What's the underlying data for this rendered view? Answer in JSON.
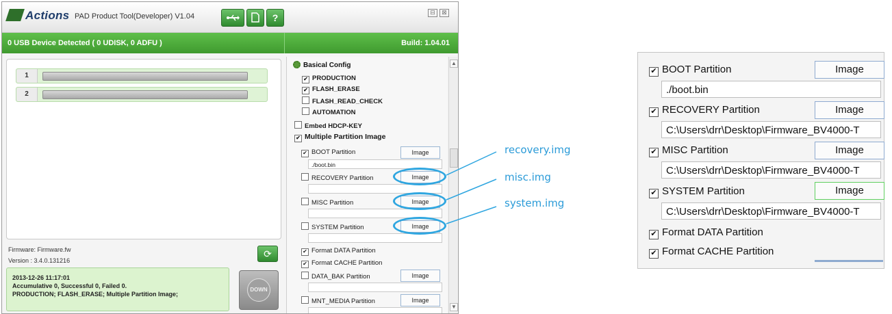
{
  "app": {
    "logo": "Actions",
    "title": "PAD Product Tool(Developer) V1.04",
    "toolbar": {
      "usb_icon": "usb-icon",
      "doc_icon": "document-icon",
      "help_label": "?"
    },
    "window_controls": {
      "minimize": "⊟",
      "close": "⊠"
    }
  },
  "status": {
    "left": "0 USB Device Detected ( 0 UDISK, 0 ADFU )",
    "right": "Build: 1.04.01"
  },
  "slots": [
    {
      "label": "1"
    },
    {
      "label": "2"
    }
  ],
  "firmware": {
    "file": "Firmware: Firmware.fw",
    "version": "Version : 3.4.0.131216"
  },
  "log": {
    "line1": "2013-12-26 11:17:01",
    "line2": "Accumulative 0, Successful 0, Failed 0.",
    "line3": "PRODUCTION; FLASH_ERASE; Multiple Partition Image;"
  },
  "down_button": {
    "label": "DOWN"
  },
  "config": {
    "title": "Basical Config",
    "options": [
      {
        "label": "PRODUCTION",
        "checked": true
      },
      {
        "label": "FLASH_ERASE",
        "checked": true
      },
      {
        "label": "FLASH_READ_CHECK",
        "checked": false
      },
      {
        "label": "AUTOMATION",
        "checked": false
      }
    ],
    "embed_hdcp": {
      "label": "Embed HDCP-KEY",
      "checked": false
    },
    "multi_image": {
      "label": "Multiple Partition Image",
      "checked": true
    },
    "partitions": [
      {
        "label": "BOOT Partition",
        "checked": true,
        "button": "Image",
        "path": "./boot.bin"
      },
      {
        "label": "RECOVERY Partition",
        "checked": false,
        "button": "Image",
        "path": ""
      },
      {
        "label": "MISC Partition",
        "checked": false,
        "button": "Image",
        "path": ""
      },
      {
        "label": "SYSTEM Partition",
        "checked": false,
        "button": "Image",
        "path": ""
      }
    ],
    "format_data": {
      "label": "Format DATA Partition",
      "checked": true
    },
    "format_cache": {
      "label": "Format CACHE Partition",
      "checked": true
    },
    "extra_partitions": [
      {
        "label": "DATA_BAK Partition",
        "checked": false,
        "button": "Image",
        "path": ""
      },
      {
        "label": "MNT_MEDIA Partition",
        "checked": false,
        "button": "Image",
        "path": ""
      }
    ]
  },
  "annotations": {
    "recovery": "recovery.img",
    "misc": "misc.img",
    "system": "system.img",
    "color": "#2b9bd8"
  },
  "zoom": {
    "partitions": [
      {
        "label": "BOOT Partition",
        "checked": true,
        "button": "Image",
        "path": "./boot.bin"
      },
      {
        "label": "RECOVERY Partition",
        "checked": true,
        "button": "Image",
        "path": "C:\\Users\\drr\\Desktop\\Firmware_BV4000-T"
      },
      {
        "label": "MISC Partition",
        "checked": true,
        "button": "Image",
        "path": "C:\\Users\\drr\\Desktop\\Firmware_BV4000-T"
      },
      {
        "label": "SYSTEM Partition",
        "checked": true,
        "button": "Image",
        "path": "C:\\Users\\drr\\Desktop\\Firmware_BV4000-T"
      }
    ],
    "format_data": {
      "label": "Format DATA Partition",
      "checked": true
    },
    "format_cache": {
      "label": "Format CACHE Partition",
      "checked": true
    }
  },
  "colors": {
    "accent_green": "#4aaa38",
    "annotation_blue": "#2b9bd8"
  }
}
